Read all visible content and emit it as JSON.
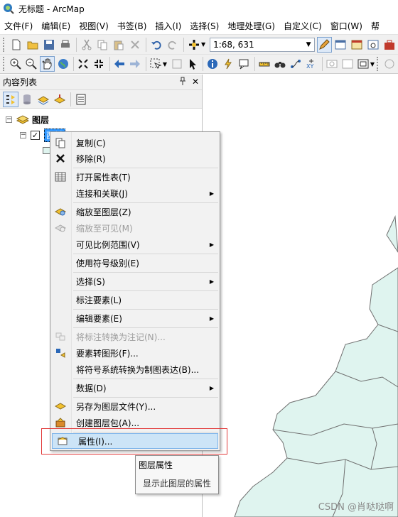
{
  "window": {
    "title": "无标题 - ArcMap"
  },
  "menubar": {
    "items": [
      "文件(F)",
      "编辑(E)",
      "视图(V)",
      "书签(B)",
      "插入(I)",
      "选择(S)",
      "地理处理(G)",
      "自定义(C)",
      "窗口(W)",
      "帮"
    ]
  },
  "toolbar": {
    "scale_value": "1:68, 631"
  },
  "toc": {
    "title": "内容列表",
    "pin": "ᵖ",
    "close": "✕",
    "root_label": "图层",
    "layer_label": "西城"
  },
  "context_menu": {
    "items": [
      {
        "label": "复制(C)",
        "icon": "copy-icon",
        "enabled": true
      },
      {
        "label": "移除(R)",
        "icon": "remove-icon",
        "enabled": true
      },
      {
        "label": "打开属性表(T)",
        "icon": "table-icon",
        "enabled": true
      },
      {
        "label": "连接和关联(J)",
        "icon": "",
        "enabled": true,
        "submenu": true
      },
      {
        "label": "缩放至图层(Z)",
        "icon": "zoom-to-layer-icon",
        "enabled": true
      },
      {
        "label": "缩放至可见(M)",
        "icon": "zoom-visible-icon",
        "enabled": false
      },
      {
        "label": "可见比例范围(V)",
        "icon": "",
        "enabled": true,
        "submenu": true
      },
      {
        "label": "使用符号级别(E)",
        "icon": "",
        "enabled": true
      },
      {
        "label": "选择(S)",
        "icon": "",
        "enabled": true,
        "submenu": true
      },
      {
        "label": "标注要素(L)",
        "icon": "",
        "enabled": true
      },
      {
        "label": "编辑要素(E)",
        "icon": "",
        "enabled": true,
        "submenu": true
      },
      {
        "label": "将标注转换为注记(N)...",
        "icon": "convert-labels-icon",
        "enabled": false
      },
      {
        "label": "要素转图形(F)...",
        "icon": "features-to-graphics-icon",
        "enabled": true
      },
      {
        "label": "将符号系统转换为制图表达(B)...",
        "icon": "",
        "enabled": true
      },
      {
        "label": "数据(D)",
        "icon": "",
        "enabled": true,
        "submenu": true
      },
      {
        "label": "另存为图层文件(Y)...",
        "icon": "save-layer-icon",
        "enabled": true
      },
      {
        "label": "创建图层包(A)...",
        "icon": "layer-package-icon",
        "enabled": true
      },
      {
        "label": "属性(I)...",
        "icon": "properties-icon",
        "enabled": true
      }
    ]
  },
  "tooltip": {
    "title": "图层属性",
    "description": "显示此图层的属性"
  },
  "watermark": "CSDN @肖哒哒啊",
  "colors": {
    "map_fill": "#dff4ef",
    "map_stroke": "#6f6f6f",
    "highlight": "#cce4f7",
    "annotation_frame": "#e23b3b"
  }
}
